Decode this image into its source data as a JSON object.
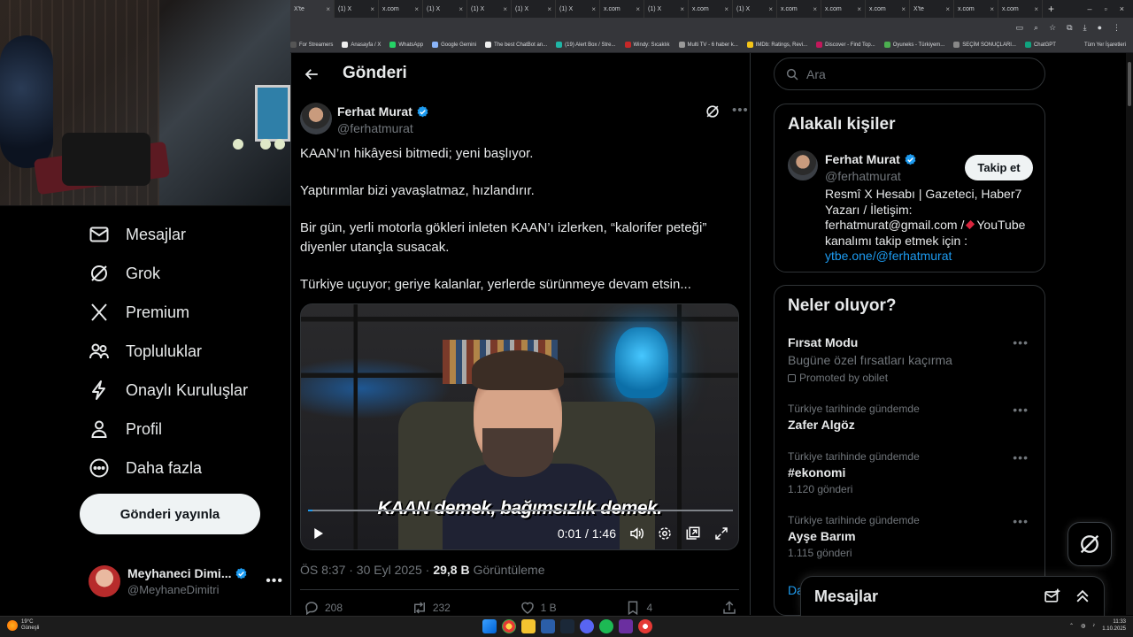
{
  "browser": {
    "tabs": [
      "X'te",
      "(1) X",
      "x.com",
      "(1) X",
      "(1) X",
      "(1) X",
      "(1) X",
      "x.com",
      "(1) X",
      "x.com",
      "(1) X",
      "x.com",
      "x.com",
      "x.com",
      "X'te",
      "x.com",
      "x.com"
    ],
    "bookmarks": [
      "For Streamers",
      "Anasayfa / X",
      "WhatsApp",
      "Google Gemini",
      "The best ChatBot an...",
      "(19) Alert Box / Stre...",
      "Windy: Sıcaklık",
      "Multi TV - 6 haber k...",
      "IMDb: Ratings, Revi...",
      "Discover - Find Top...",
      "Oyuneks - Türkiyem...",
      "SEÇİM SONUÇLARI...",
      "ChatGPT"
    ],
    "bookmarks_right": "Tüm Yer İşaretleri"
  },
  "nav": {
    "items": [
      {
        "label": "Mesajlar",
        "icon": "envelope-icon"
      },
      {
        "label": "Grok",
        "icon": "grok-icon"
      },
      {
        "label": "Premium",
        "icon": "x-logo-icon"
      },
      {
        "label": "Topluluklar",
        "icon": "people-icon"
      },
      {
        "label": "Onaylı Kuruluşlar",
        "icon": "lightning-icon"
      },
      {
        "label": "Profil",
        "icon": "person-icon"
      },
      {
        "label": "Daha fazla",
        "icon": "more-circle-icon"
      }
    ],
    "post_button": "Gönderi yayınla",
    "account": {
      "name": "Meyhaneci Dimi...",
      "handle": "@MeyhaneDimitri"
    }
  },
  "main": {
    "title": "Gönderi",
    "author": {
      "name": "Ferhat Murat",
      "handle": "@ferhatmurat"
    },
    "text": [
      "KAAN’ın hikâyesi bitmedi; yeni başlıyor.",
      "Yaptırımlar bizi yavaşlatmaz, hızlandırır.",
      "Bir gün, yerli motorla gökleri inleten KAAN’ı izlerken, “kalorifer peteği”",
      "diyenler utançla susacak.",
      "Türkiye uçuyor; geriye kalanlar, yerlerde sürünmeye devam etsin..."
    ],
    "video": {
      "caption": "KAAN demek, bağımsızlık demek.",
      "time": "0:01 / 1:46",
      "progress": 0.01
    },
    "meta": {
      "time": "ÖS 8:37 · 30 Eyl 2025 ·",
      "views": "29,8 B",
      "views_label": "Görüntüleme"
    },
    "actions": {
      "replies": "208",
      "reposts": "232",
      "likes": "1 B",
      "bookmarks": "4"
    }
  },
  "right": {
    "search_placeholder": "Ara",
    "related": {
      "title": "Alakalı kişiler",
      "name": "Ferhat Murat",
      "handle": "@ferhatmurat",
      "follow": "Takip et",
      "bio_1": "Resmî X Hesabı | Gazeteci, Haber7 Yazarı / İletişim: ferhatmurat@gmail.com /",
      "bio_2": "YouTube kanalımı takip etmek için :",
      "bio_link": "ytbe.one/@ferhatmurat"
    },
    "trends": {
      "title": "Neler oluyor?",
      "items": [
        {
          "title": "Fırsat Modu",
          "desc": "Bugüne özel fırsatları kaçırma",
          "promo": "Promoted by obilet"
        },
        {
          "context": "Türkiye tarihinde gündemde",
          "title": "Zafer Algöz"
        },
        {
          "context": "Türkiye tarihinde gündemde",
          "title": "#ekonomi",
          "count": "1.120 gönderi"
        },
        {
          "context": "Türkiye tarihinde gündemde",
          "title": "Ayşe Barım",
          "count": "1.115 gönderi"
        }
      ],
      "show_more": "Da"
    },
    "messages_drawer": "Mesajlar"
  },
  "taskbar": {
    "weather_temp": "19°C",
    "weather_desc": "Güneşli",
    "clock_time": "11:33",
    "clock_date": "1.10.2025"
  },
  "colors": {
    "accent": "#1d9bf0",
    "bg": "#000000",
    "text": "#e7e9ea",
    "muted": "#71767b",
    "border": "#2f3336"
  }
}
